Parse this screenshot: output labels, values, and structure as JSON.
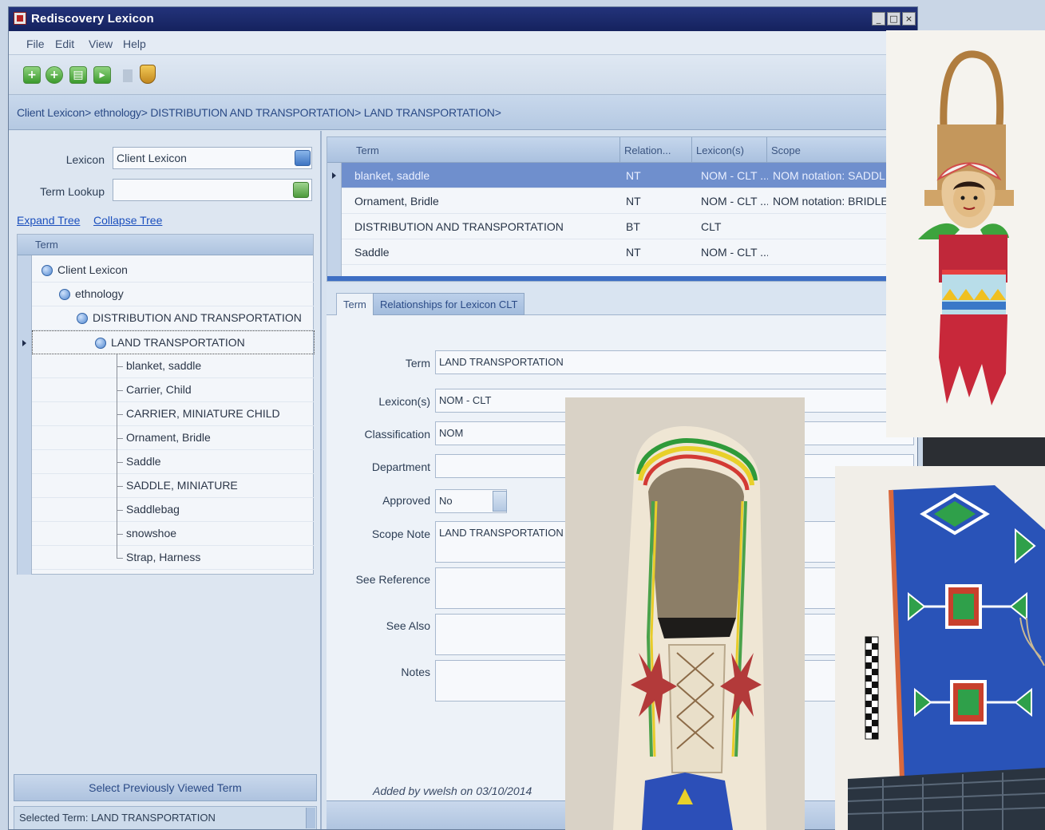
{
  "window": {
    "title": "Rediscovery Lexicon",
    "controls": {
      "minimize": "_",
      "maximize": "□",
      "close": "×"
    }
  },
  "menu": [
    "File",
    "Edit",
    "View",
    "Help"
  ],
  "toolbar": {
    "icons": [
      "add-green-icon",
      "plus-green-icon",
      "save-green-icon",
      "forward-green-icon",
      "shield-icon"
    ],
    "glyphs": [
      "+",
      "+",
      "▤",
      "▸"
    ]
  },
  "breadcrumb": "Client Lexicon> ethnology> DISTRIBUTION AND TRANSPORTATION> LAND TRANSPORTATION>",
  "left": {
    "lexicon_label": "Lexicon",
    "lexicon_value": "Client Lexicon",
    "term_lookup_label": "Term Lookup",
    "term_lookup_value": "",
    "expand_tree": "Expand Tree",
    "collapse_tree": "Collapse Tree",
    "tree_header": "Term",
    "tree": [
      {
        "text": "Client Lexicon",
        "level": 0
      },
      {
        "text": "ethnology",
        "level": 1
      },
      {
        "text": "DISTRIBUTION AND TRANSPORTATION",
        "level": 2
      },
      {
        "text": "LAND TRANSPORTATION",
        "level": 3
      },
      {
        "text": "blanket, saddle",
        "level": 4
      },
      {
        "text": "Carrier, Child",
        "level": 4
      },
      {
        "text": "CARRIER, MINIATURE CHILD",
        "level": 4
      },
      {
        "text": "Ornament, Bridle",
        "level": 4
      },
      {
        "text": "Saddle",
        "level": 4
      },
      {
        "text": "SADDLE, MINIATURE",
        "level": 4
      },
      {
        "text": "Saddlebag",
        "level": 4
      },
      {
        "text": "snowshoe",
        "level": 4
      },
      {
        "text": "Strap, Harness",
        "level": 4
      }
    ],
    "select_previous": "Select Previously Viewed Term",
    "selected_term": "Selected Term: LAND TRANSPORTATION"
  },
  "grid": {
    "columns": [
      "Term",
      "Relation...",
      "Lexicon(s)",
      "Scope"
    ],
    "rows": [
      [
        "blanket, saddle",
        "NT",
        "NOM - CLT ...",
        "NOM notation: SADDLE BL"
      ],
      [
        "Ornament, Bridle",
        "NT",
        "NOM - CLT ...",
        "NOM notation: BRIDLE OR"
      ],
      [
        "DISTRIBUTION AND TRANSPORTATION",
        "BT",
        "CLT",
        ""
      ],
      [
        "Saddle",
        "NT",
        "NOM - CLT ...",
        ""
      ]
    ]
  },
  "tabs": [
    "Term",
    "Relationships for Lexicon CLT"
  ],
  "form": {
    "fields": [
      {
        "label": "Term",
        "value": "LAND TRANSPORTATION"
      },
      {
        "label": "Lexicon(s)",
        "value": "NOM - CLT"
      },
      {
        "label": "Classification",
        "value": "NOM"
      },
      {
        "label": "Department",
        "value": ""
      },
      {
        "label": "Approved",
        "value": "No"
      },
      {
        "label": "Scope Note",
        "value": "LAND TRANSPORTATION --"
      },
      {
        "label": "See Reference",
        "value": ""
      },
      {
        "label": "See Also",
        "value": ""
      },
      {
        "label": "Notes",
        "value": ""
      }
    ],
    "added_by": "Added by vwelsh on 03/10/2014"
  },
  "colors": {
    "title_bar": "#1a2868",
    "selection": "#6f8fcd",
    "link": "#1b4fbd",
    "accent_green": "#3b9a2d"
  }
}
